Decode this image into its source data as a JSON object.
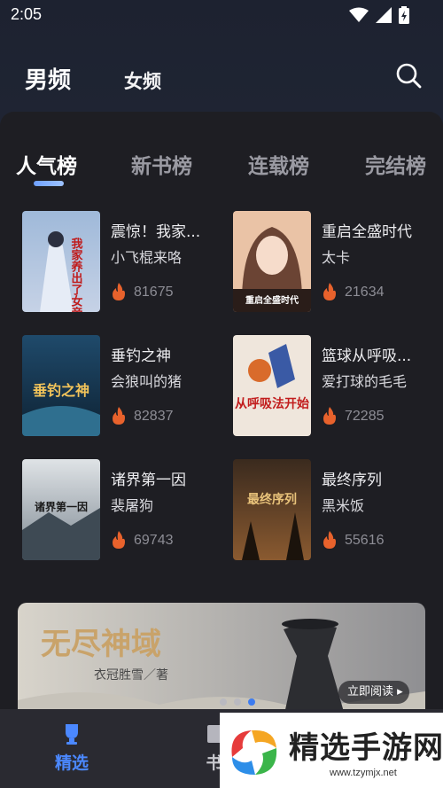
{
  "status_bar": {
    "time": "2:05"
  },
  "top_tabs": [
    {
      "label": "男频",
      "active": true
    },
    {
      "label": "女频",
      "active": false
    }
  ],
  "rank_tabs": [
    {
      "label": "人气榜",
      "active": true
    },
    {
      "label": "新书榜",
      "active": false
    },
    {
      "label": "连载榜",
      "active": false
    },
    {
      "label": "完结榜",
      "active": false
    }
  ],
  "books": [
    {
      "title": "震惊！我家...",
      "author": "小飞棍来咯",
      "heat": "81675",
      "cover_text": "我家养出了女帝王朝"
    },
    {
      "title": "重启全盛时代",
      "author": "太卡",
      "heat": "21634",
      "cover_text": "重启全盛时代"
    },
    {
      "title": "垂钓之神",
      "author": "会狼叫的猪",
      "heat": "82837",
      "cover_text": "垂钓之神"
    },
    {
      "title": "篮球从呼吸...",
      "author": "爱打球的毛毛",
      "heat": "72285",
      "cover_text": "从呼吸法开始"
    },
    {
      "title": "诸界第一因",
      "author": "裴屠狗",
      "heat": "69743",
      "cover_text": "诸界第一因"
    },
    {
      "title": "最终序列",
      "author": "黑米饭",
      "heat": "55616",
      "cover_text": "最终序列"
    }
  ],
  "banner": {
    "title": "无尽神域",
    "author_line": "衣冠胜雪／著",
    "button": "立即阅读 ▸",
    "active_dot": 2
  },
  "bottom_nav": [
    {
      "label": "精选",
      "active": true,
      "icon": "trophy-icon"
    },
    {
      "label": "书",
      "active": false,
      "icon": "bookshelf-icon"
    }
  ],
  "watermark": {
    "text": "精选手游网",
    "url": "www.tzymjx.net"
  },
  "colors": {
    "accent": "#4b88ff",
    "sheet": "#1e1e23",
    "fire": "#e8622c"
  }
}
